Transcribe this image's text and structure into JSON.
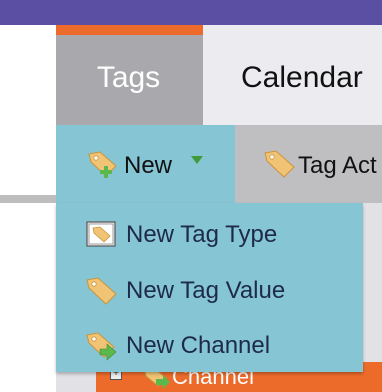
{
  "tabs": [
    {
      "label": "Tags",
      "active": true
    },
    {
      "label": "Calendar",
      "active": false
    }
  ],
  "toolbar": {
    "new_label": "New",
    "tag_actions_label": "Tag Act"
  },
  "menu": {
    "items": [
      {
        "label": "New Tag Type",
        "icon": "tag-type-icon"
      },
      {
        "label": "New Tag Value",
        "icon": "tag-value-icon"
      },
      {
        "label": "New Channel",
        "icon": "new-channel-icon"
      }
    ]
  },
  "tree": {
    "row_label": "Channel"
  },
  "colors": {
    "header_bar": "#5a4fa3",
    "active_tab": "#a9a9ad",
    "active_tab_accent": "#ec6b2a",
    "inactive_tab": "#ebebf0",
    "menu_bg": "#86c5d3",
    "tag_icon": "#f1c375",
    "add_icon_green": "#5bb84a",
    "tree_row": "#ec6b2a"
  }
}
